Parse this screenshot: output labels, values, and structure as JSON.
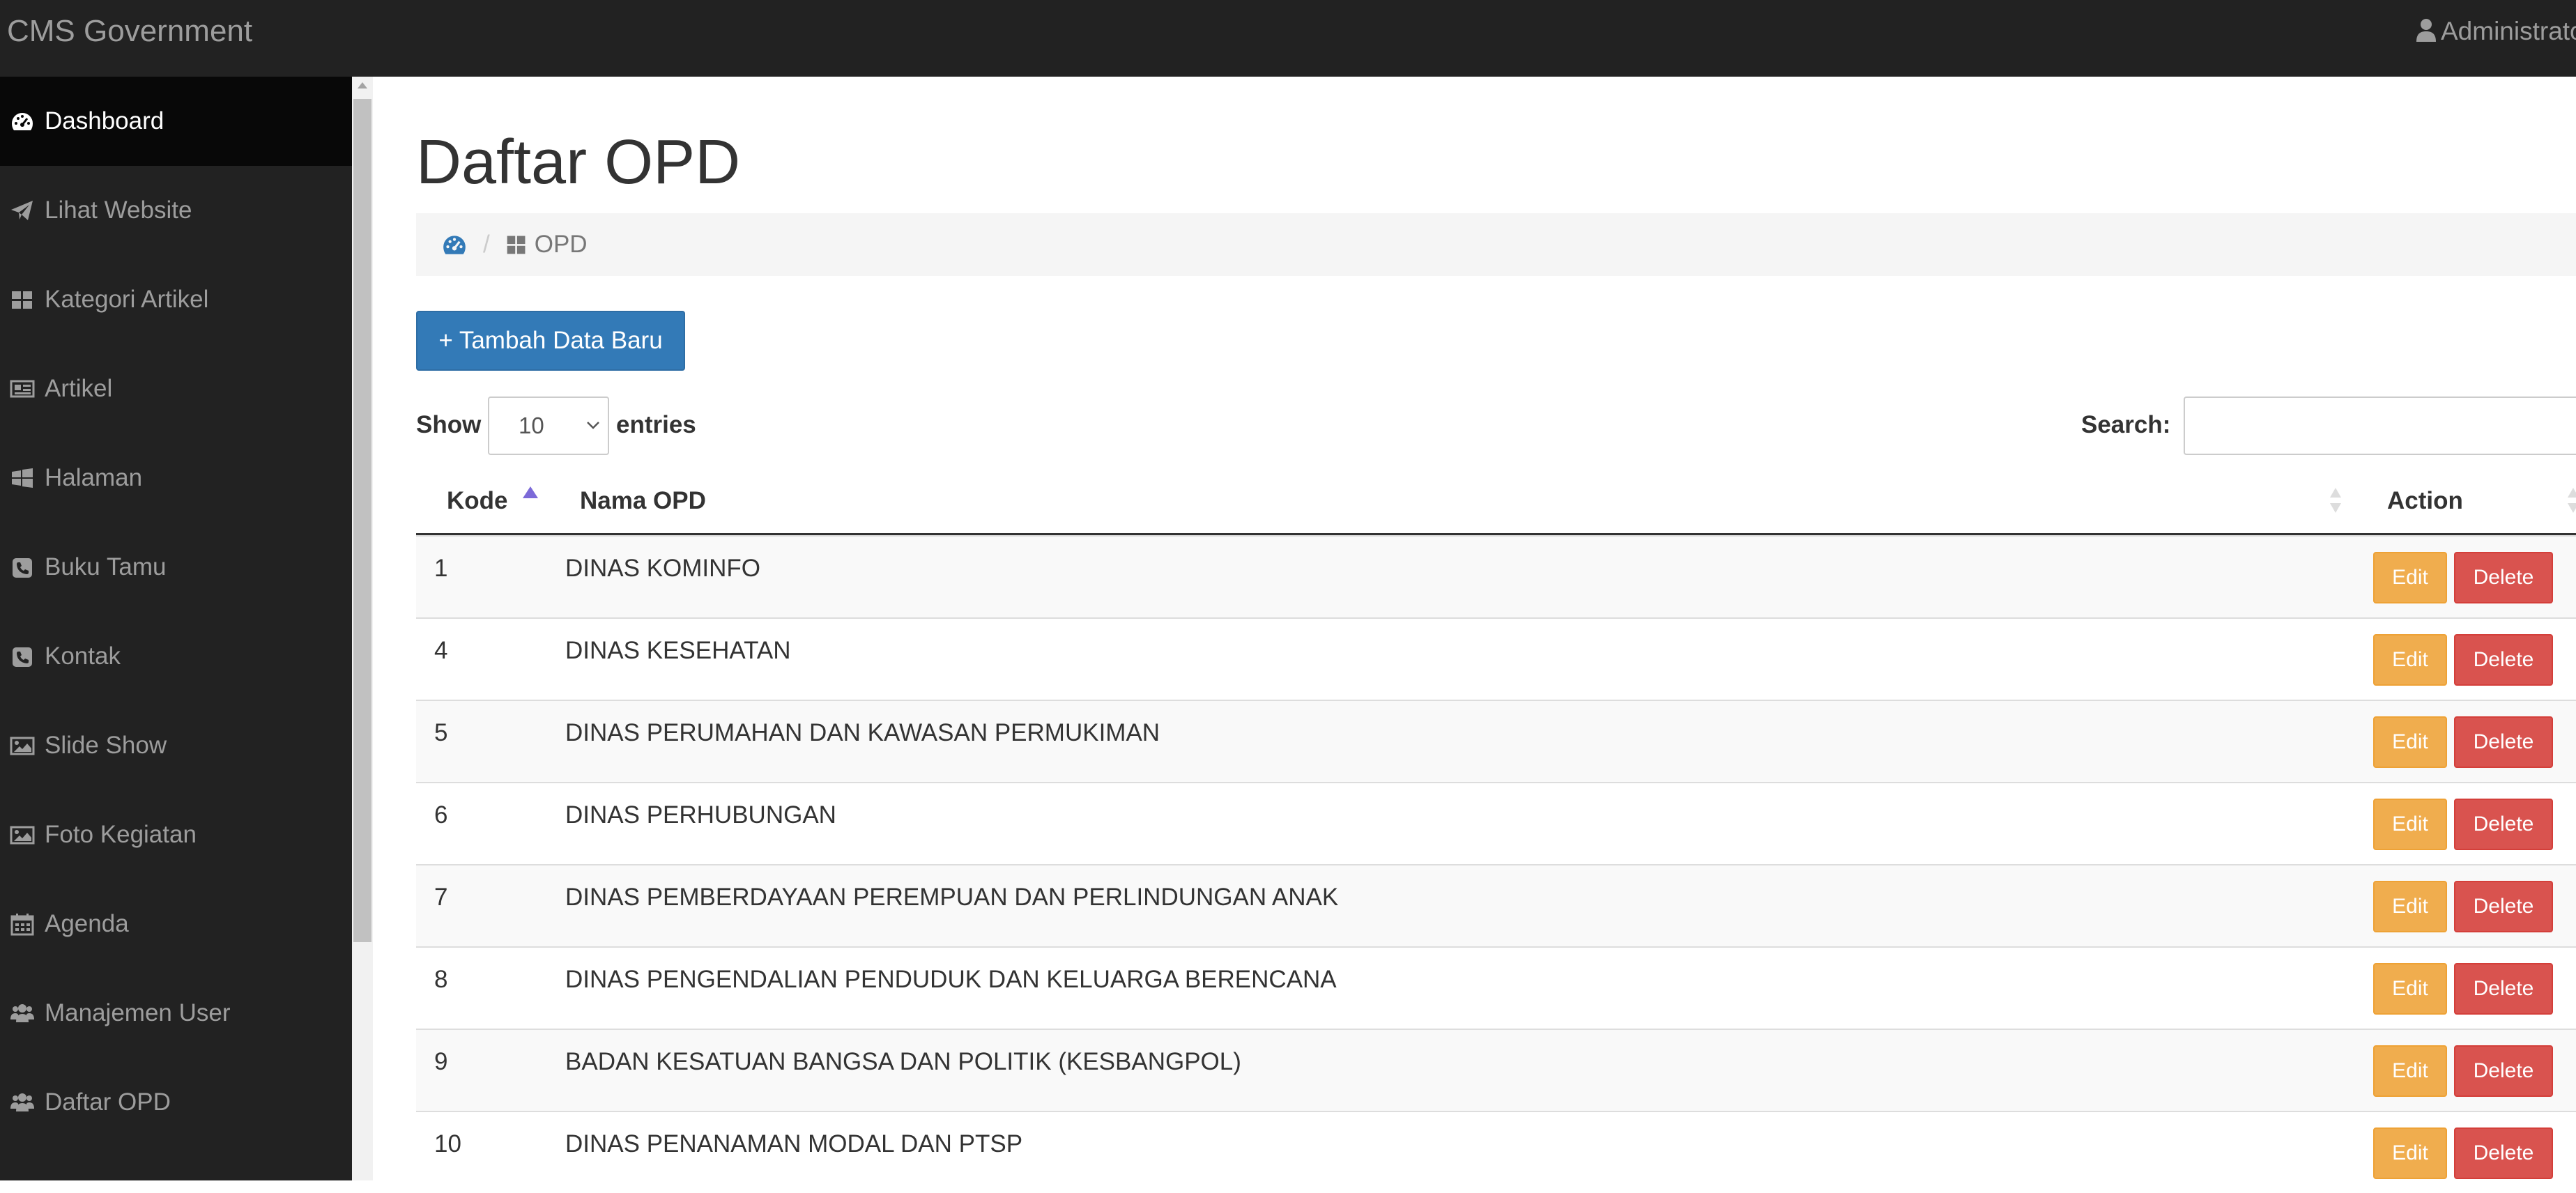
{
  "app": {
    "brand": "CMS Government",
    "user_label": "Administrator"
  },
  "sidebar": {
    "items": [
      {
        "label": "Dashboard",
        "icon": "dashboard-icon"
      },
      {
        "label": "Lihat Website",
        "icon": "paper-plane-icon"
      },
      {
        "label": "Kategori Artikel",
        "icon": "grid-icon"
      },
      {
        "label": "Artikel",
        "icon": "newspaper-icon"
      },
      {
        "label": "Halaman",
        "icon": "windows-icon"
      },
      {
        "label": "Buku Tamu",
        "icon": "phone-square-icon"
      },
      {
        "label": "Kontak",
        "icon": "phone-square-icon"
      },
      {
        "label": "Slide Show",
        "icon": "picture-icon"
      },
      {
        "label": "Foto Kegiatan",
        "icon": "picture-icon"
      },
      {
        "label": "Agenda",
        "icon": "calendar-icon"
      },
      {
        "label": "Manajemen User",
        "icon": "users-icon"
      },
      {
        "label": "Daftar OPD",
        "icon": "users-icon"
      }
    ],
    "active_index": 0
  },
  "main": {
    "title": "Daftar OPD",
    "breadcrumb": {
      "current": "OPD"
    },
    "add_button": "+ Tambah Data Baru",
    "length": {
      "show": "Show",
      "value": "10",
      "entries": "entries"
    },
    "search": {
      "label": "Search:",
      "value": ""
    },
    "table": {
      "columns": [
        "Kode",
        "Nama OPD",
        "Action"
      ],
      "edit_label": "Edit",
      "delete_label": "Delete",
      "rows": [
        {
          "kode": "1",
          "nama": "DINAS KOMINFO"
        },
        {
          "kode": "4",
          "nama": "DINAS KESEHATAN"
        },
        {
          "kode": "5",
          "nama": "DINAS PERUMAHAN DAN KAWASAN PERMUKIMAN"
        },
        {
          "kode": "6",
          "nama": "DINAS PERHUBUNGAN"
        },
        {
          "kode": "7",
          "nama": "DINAS PEMBERDAYAAN PEREMPUAN DAN PERLINDUNGAN ANAK"
        },
        {
          "kode": "8",
          "nama": "DINAS PENGENDALIAN PENDUDUK DAN KELUARGA BERENCANA"
        },
        {
          "kode": "9",
          "nama": "BADAN KESATUAN BANGSA DAN POLITIK (KESBANGPOL)"
        },
        {
          "kode": "10",
          "nama": "DINAS PENANAMAN MODAL DAN PTSP"
        }
      ]
    }
  },
  "colors": {
    "navbar": "#222222",
    "sidebar_active": "#080808",
    "primary": "#337ab7",
    "warning": "#f0ad4e",
    "danger": "#d9534f"
  }
}
